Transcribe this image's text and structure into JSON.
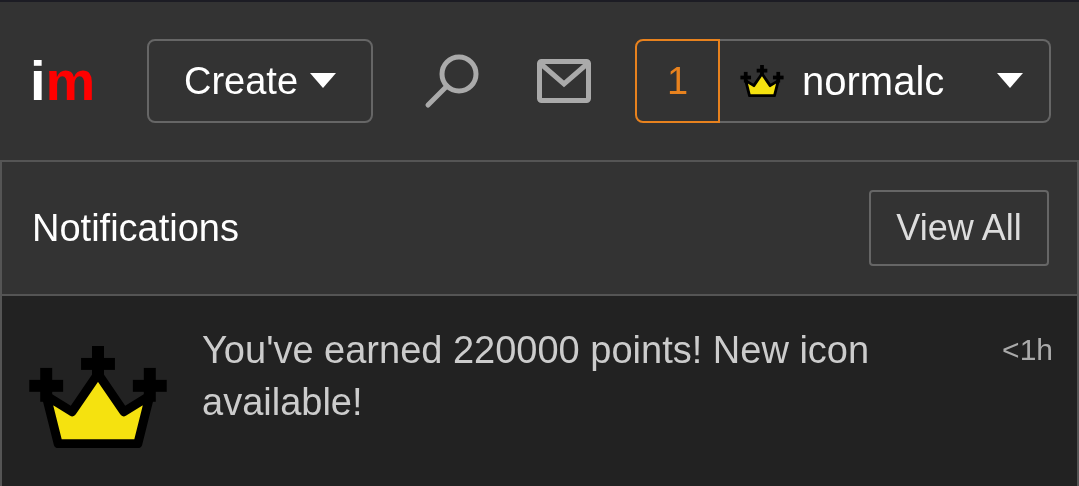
{
  "logo": [
    {
      "text": "i",
      "color": "#ffffff"
    },
    {
      "text": "m",
      "color": "#ff0000"
    }
  ],
  "create_button": {
    "label": "Create"
  },
  "notification_count": "1",
  "user_menu": {
    "username": "normalc"
  },
  "notifications": {
    "title": "Notifications",
    "view_all": "View All",
    "items": [
      {
        "message": "You've earned 220000 points! New icon available!",
        "time": "<1h"
      }
    ]
  }
}
